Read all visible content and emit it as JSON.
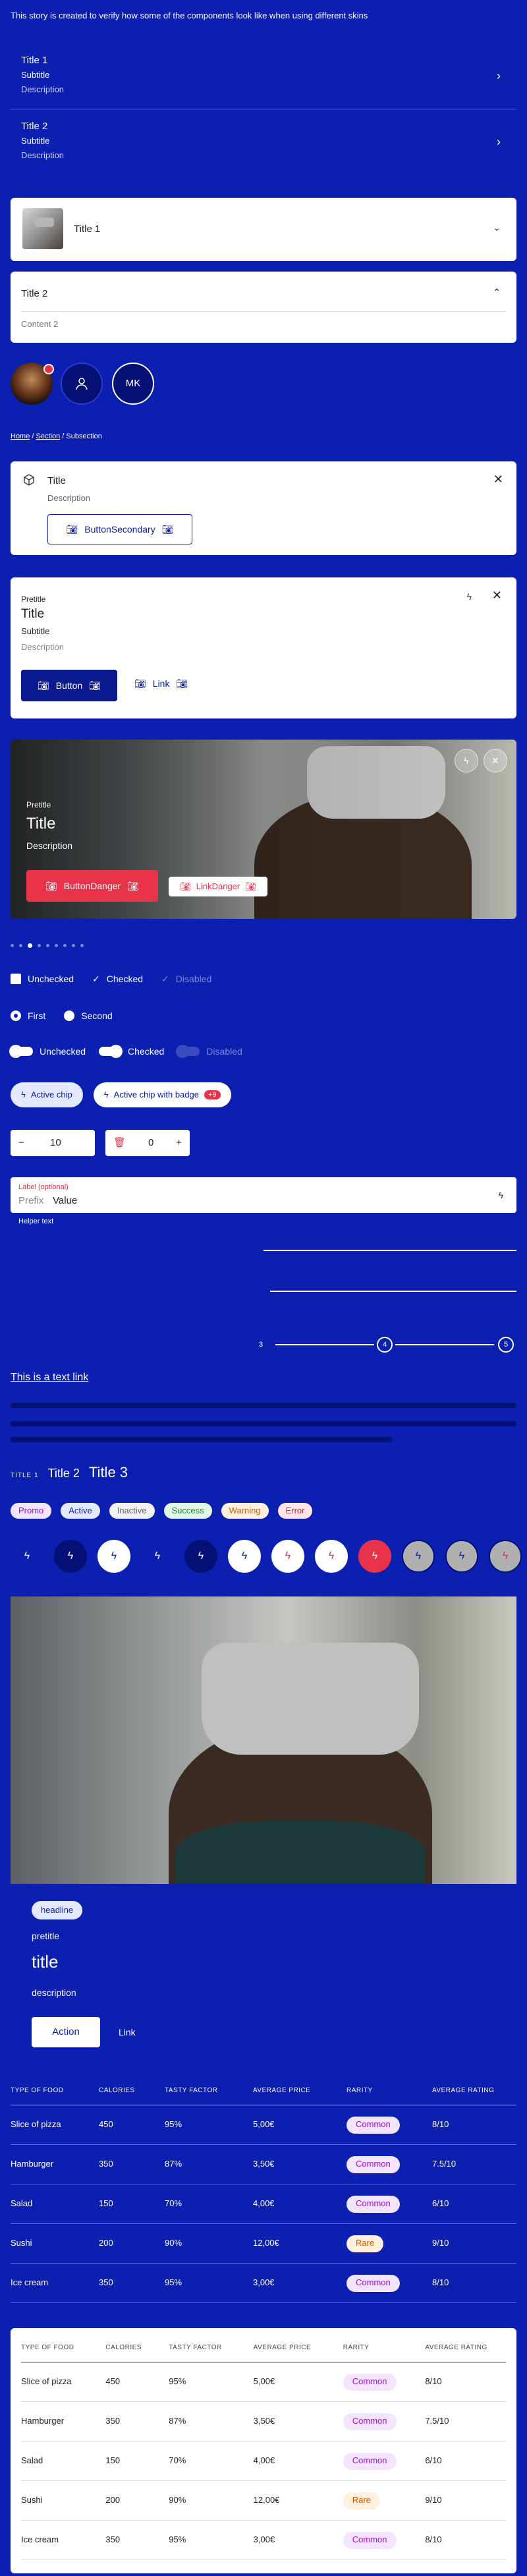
{
  "intro": "This story is created to verify how some of the components look like when using different skins",
  "list_items": [
    {
      "title": "Title 1",
      "subtitle": "Subtitle",
      "description": "Description"
    },
    {
      "title": "Title 2",
      "subtitle": "Subtitle",
      "description": "Description"
    }
  ],
  "accordion": {
    "item1_title": "Title 1",
    "item2_title": "Title 2",
    "item2_content": "Content 2"
  },
  "avatars": {
    "initials": "MK"
  },
  "breadcrumb": {
    "home": "Home",
    "section": "Section",
    "subsection": "Subsection"
  },
  "dialog1": {
    "title": "Title",
    "description": "Description",
    "button": "ButtonSecondary"
  },
  "dialog2": {
    "pretitle": "Pretitle",
    "title": "Title",
    "subtitle": "Subtitle",
    "description": "Description",
    "button": "Button",
    "link": "Link"
  },
  "hero": {
    "pretitle": "Pretitle",
    "title": "Title",
    "description": "Description",
    "button": "ButtonDanger",
    "link": "LinkDanger"
  },
  "checkboxes": [
    "Unchecked",
    "Checked",
    "Disabled"
  ],
  "radios": [
    "First",
    "Second"
  ],
  "switches": [
    "Unchecked",
    "Checked",
    "Disabled"
  ],
  "chips": {
    "chip1": "Active chip",
    "chip2": "Active chip with badge",
    "badge": "+9"
  },
  "steppers": {
    "value1": "10",
    "value2": "0"
  },
  "field": {
    "label": "Label (optional)",
    "prefix": "Prefix",
    "value": "Value",
    "helper": "Helper text"
  },
  "stepper_labels": {
    "step3": "3",
    "step4": "4",
    "step5": "5"
  },
  "text_link": "This is a text link",
  "titles": {
    "title1": "TITLE 1",
    "title2": "Title 2",
    "title3": "Title 3"
  },
  "tags": [
    {
      "label": "Promo",
      "bg": "#f3e4ff",
      "fg": "#a010c8"
    },
    {
      "label": "Active",
      "bg": "#e4e9ff",
      "fg": "#0b1fb0"
    },
    {
      "label": "Inactive",
      "bg": "#f0f0f0",
      "fg": "#666666"
    },
    {
      "label": "Success",
      "bg": "#e2f7e8",
      "fg": "#1a8a3a"
    },
    {
      "label": "Warning",
      "bg": "#fff1de",
      "fg": "#d05a00"
    },
    {
      "label": "Error",
      "bg": "#ffe4e8",
      "fg": "#d0223a"
    }
  ],
  "media_card": {
    "headline": "headline",
    "pretitle": "pretitle",
    "title": "title",
    "description": "description",
    "button": "Action",
    "link": "Link"
  },
  "table": {
    "headers": [
      "TYPE OF FOOD",
      "CALORIES",
      "TASTY FACTOR",
      "AVERAGE PRICE",
      "RARITY",
      "AVERAGE RATING"
    ],
    "rows": [
      [
        "Slice of pizza",
        "450",
        "95%",
        "5,00€",
        "Common",
        "8/10"
      ],
      [
        "Hamburger",
        "350",
        "87%",
        "3,50€",
        "Common",
        "7.5/10"
      ],
      [
        "Salad",
        "150",
        "70%",
        "4,00€",
        "Common",
        "6/10"
      ],
      [
        "Sushi",
        "200",
        "90%",
        "12,00€",
        "Rare",
        "9/10"
      ],
      [
        "Ice cream",
        "350",
        "95%",
        "3,00€",
        "Common",
        "8/10"
      ]
    ]
  },
  "colors": {
    "brand": "#0b1fb0",
    "danger": "#e8324a"
  }
}
